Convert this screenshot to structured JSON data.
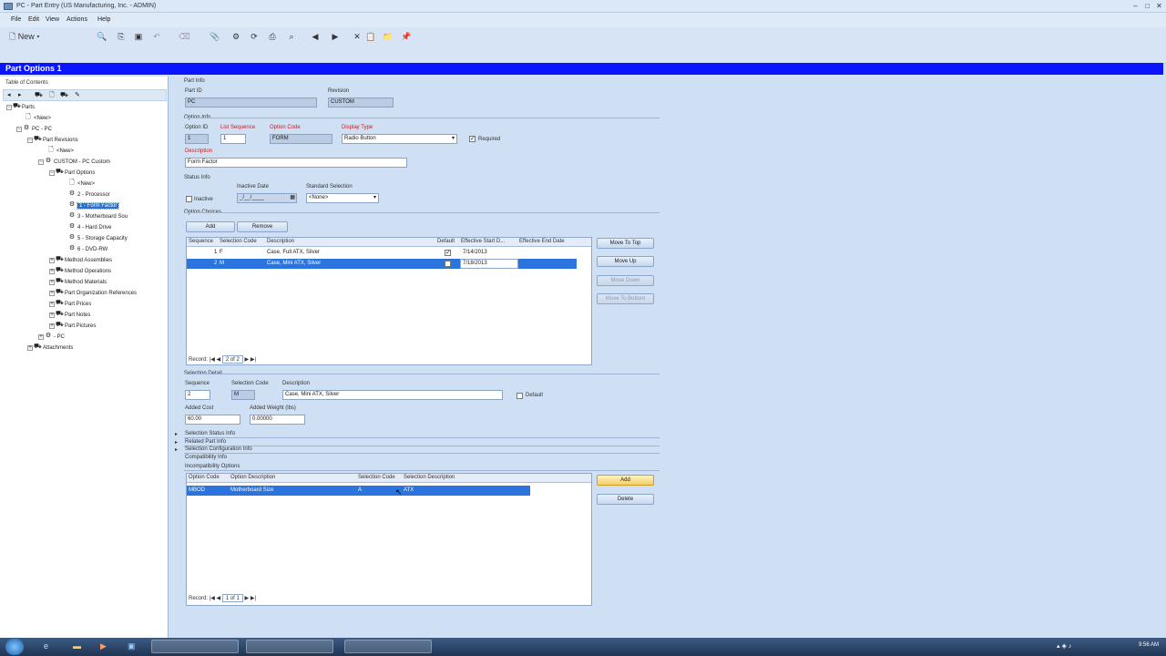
{
  "window": {
    "title": "PC - Part Entry (US Manufacturing, Inc. - ADMIN)"
  },
  "menu": [
    "File",
    "Edit",
    "View",
    "Actions",
    "Help"
  ],
  "toolbar": {
    "new_label": "New"
  },
  "form": {
    "title": "Part Options 1"
  },
  "toc": {
    "label": "Table of Contents",
    "nodes": [
      {
        "label": "Parts"
      },
      {
        "label": "<New>"
      },
      {
        "label": "PC - PC"
      },
      {
        "label": "Part Revisions"
      },
      {
        "label": "<New>"
      },
      {
        "label": "CUSTOM - PC Custom"
      },
      {
        "label": "Part Options"
      },
      {
        "label": "<New>"
      },
      {
        "label": "2 - Processor"
      },
      {
        "label": "1 - Form Factor"
      },
      {
        "label": "3 - Motherboard Sou"
      },
      {
        "label": "4 - Hard Drive"
      },
      {
        "label": "5 - Storage Capacity"
      },
      {
        "label": "6 - DVD-RW"
      },
      {
        "label": "Method Assemblies"
      },
      {
        "label": "Method Operations"
      },
      {
        "label": "Method Materials"
      },
      {
        "label": "Part Organization References"
      },
      {
        "label": "Part Prices"
      },
      {
        "label": "Part Notes"
      },
      {
        "label": "Part Pictures"
      },
      {
        "label": "- PC"
      },
      {
        "label": "Attachments"
      }
    ]
  },
  "part_info": {
    "section": "Part Info",
    "part_id_label": "Part ID",
    "part_id": "PC",
    "revision_label": "Revision",
    "revision": "CUSTOM"
  },
  "option_info": {
    "section": "Option Info",
    "option_id_label": "Option ID",
    "option_id": "1",
    "list_sequence_label": "List Sequence",
    "list_sequence": "1",
    "option_code_label": "Option Code",
    "option_code": "FORM",
    "display_type_label": "Display Type",
    "display_type": "Radio Button",
    "required_label": "Required",
    "description_label": "Description",
    "description": "Form Factor"
  },
  "status_info": {
    "section": "Status Info",
    "inactive_label": "Inactive",
    "inactive_date_label": "Inactive Date",
    "inactive_date": "_/__/____",
    "standard_selection_label": "Standard Selection",
    "standard_selection": "<None>"
  },
  "option_choices": {
    "section": "Option Choices",
    "add_label": "Add",
    "remove_label": "Remove",
    "columns": [
      "Sequence",
      "Selection Code",
      "Description",
      "Default",
      "Effective Start D...",
      "Effective End Date"
    ],
    "rows": [
      {
        "sequence": "1",
        "code": "F",
        "description": "Case, Full ATX, Silver",
        "effective_start": "7/14/2013"
      },
      {
        "sequence": "2",
        "code": "M",
        "description": "Case, Mini ATX, Silver",
        "effective_start": "7/18/2013"
      }
    ],
    "nav_label": "Record:",
    "nav_text": "2 of 2",
    "side_buttons": [
      "Move To Top",
      "Move Up",
      "Move Down",
      "Move To Bottom"
    ]
  },
  "selection_detail": {
    "section": "Selection Detail",
    "sequence_label": "Sequence",
    "sequence": "2",
    "selection_code_label": "Selection Code",
    "selection_code": "M",
    "description_label": "Description",
    "description": "Case, Mini ATX, Silver",
    "default_label": "Default",
    "added_cost_label": "Added Cost",
    "added_cost": "60.00",
    "added_weight_label": "Added Weight (lbs)",
    "added_weight": "0.00000"
  },
  "collapsed_sections": [
    "Selection Status Info",
    "Related Part Info",
    "Selection Configuration Info"
  ],
  "compatibility": {
    "section": "Compatibility Info",
    "subsection": "Incompatibility Options",
    "columns": [
      "Option Code",
      "Option Description",
      "Selection Code",
      "Selection Description"
    ],
    "rows": [
      {
        "option_code": "MBOD",
        "option_description": "Motherboard Size",
        "selection_code": "A",
        "selection_description": "ATX"
      }
    ],
    "add_label": "Add",
    "delete_label": "Delete",
    "nav_label": "Record:",
    "nav_text": "1 of 1"
  },
  "taskbar": {
    "clock": "9:56 AM"
  }
}
